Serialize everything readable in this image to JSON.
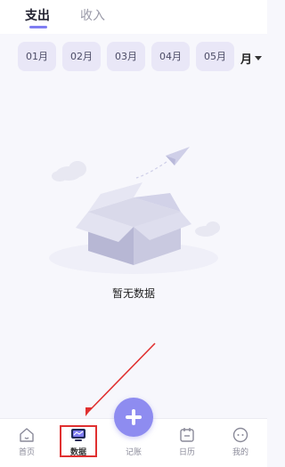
{
  "tabs": [
    {
      "label": "支出",
      "active": true
    },
    {
      "label": "收入",
      "active": false
    }
  ],
  "months": [
    "01月",
    "02月",
    "03月",
    "04月",
    "05月"
  ],
  "period_selector": {
    "label": "月",
    "icon": "caret-down-icon"
  },
  "empty_state": {
    "text": "暂无数据",
    "icon": "empty-box-icon"
  },
  "bottom_nav": [
    {
      "label": "首页",
      "icon": "home-icon"
    },
    {
      "label": "数据",
      "icon": "chart-monitor-icon",
      "active": true
    },
    {
      "label": "记账",
      "icon": "add-icon"
    },
    {
      "label": "日历",
      "icon": "calendar-icon"
    },
    {
      "label": "我的",
      "icon": "profile-icon"
    }
  ],
  "colors": {
    "accent": "#8e8cf0",
    "month_chip": "#e9e7f7",
    "annotation": "#e03030"
  }
}
